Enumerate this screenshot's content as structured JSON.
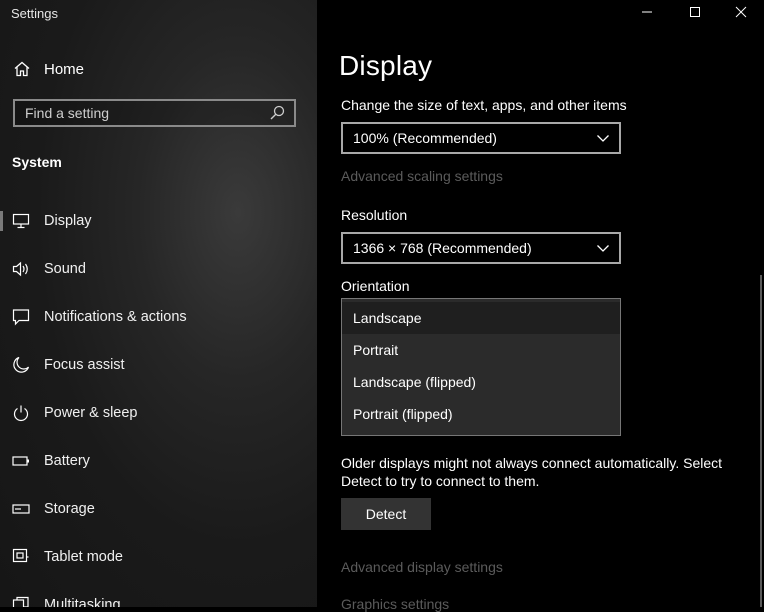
{
  "window": {
    "title": "Settings"
  },
  "sidebar": {
    "home_label": "Home",
    "search_placeholder": "Find a setting",
    "section_title": "System",
    "items": [
      {
        "label": "Display",
        "icon": "monitor-icon",
        "active": true
      },
      {
        "label": "Sound",
        "icon": "speaker-icon"
      },
      {
        "label": "Notifications & actions",
        "icon": "message-icon"
      },
      {
        "label": "Focus assist",
        "icon": "moon-icon"
      },
      {
        "label": "Power & sleep",
        "icon": "power-icon"
      },
      {
        "label": "Battery",
        "icon": "battery-icon"
      },
      {
        "label": "Storage",
        "icon": "storage-icon"
      },
      {
        "label": "Tablet mode",
        "icon": "tablet-mode-icon"
      },
      {
        "label": "Multitasking",
        "icon": "multitasking-icon"
      }
    ]
  },
  "main": {
    "page_title": "Display",
    "scale_label": "Change the size of text, apps, and other items",
    "scale_value": "100% (Recommended)",
    "advanced_scaling_link": "Advanced scaling settings",
    "resolution_label": "Resolution",
    "resolution_value": "1366 × 768 (Recommended)",
    "orientation_label": "Orientation",
    "orientation_options": [
      "Landscape",
      "Portrait",
      "Landscape (flipped)",
      "Portrait (flipped)"
    ],
    "orientation_selected": "Landscape",
    "detect_text": "Older displays might not always connect automatically. Select Detect to try to connect to them.",
    "detect_button": "Detect",
    "advanced_display_link": "Advanced display settings",
    "graphics_link": "Graphics settings"
  },
  "colors": {
    "sidebar_bg": "#1c1c1c",
    "content_bg": "#000000",
    "dim_link": "#5b5b5b",
    "button_bg": "#333333"
  }
}
